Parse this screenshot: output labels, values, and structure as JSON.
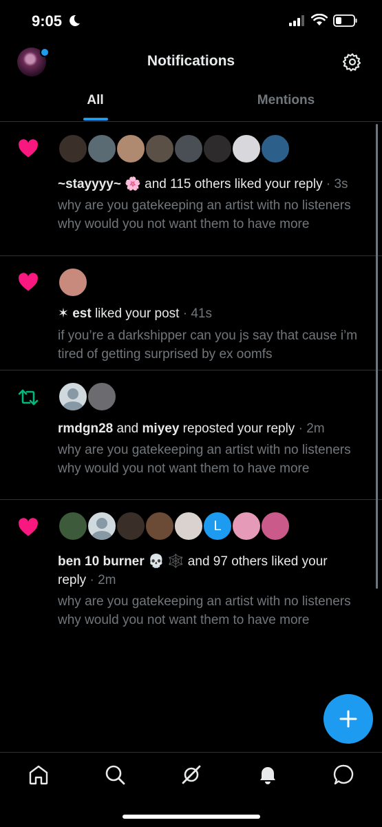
{
  "status_bar": {
    "time": "9:05"
  },
  "header": {
    "title": "Notifications"
  },
  "tabs": [
    {
      "label": "All"
    },
    {
      "label": "Mentions"
    }
  ],
  "notifications": [
    {
      "type": "like",
      "name": "~stayyyy~",
      "emoji": "🌸",
      "text": " and 115 others liked your reply",
      "time": " · 3s",
      "snippet": "why are you gatekeeping an artist with no listeners why would you not want them to have more",
      "avatar_colors": [
        "#3b2f2a",
        "#5a6b74",
        "#b08a70",
        "#5b5046",
        "#4a4f55",
        "#2e2b2c",
        "#d8d8dc",
        "#2c5f8a"
      ]
    },
    {
      "type": "like",
      "name": "✶ est",
      "text": " liked your post",
      "time": " · 41s",
      "snippet": "if you’re a darkshipper can you js say that cause i’m tired of getting surprised by ex oomfs",
      "avatar_colors": [
        "#c98a7e"
      ]
    },
    {
      "type": "repost",
      "name": "rmdgn28",
      "joiner": " and ",
      "name2": "miyey",
      "text": " reposted your reply",
      "time": " · 2m",
      "snippet": "why are you gatekeeping an artist with no listeners why would you not want them to have more",
      "avatar_colors": [
        "#cfd9de",
        "#6b6b70"
      ]
    },
    {
      "type": "like",
      "name": "ben 10 burner",
      "emoji": "💀 🕸️",
      "text": " and 97 others liked your",
      "text2": "reply",
      "time": " · 2m",
      "snippet": "why are you gatekeeping an artist with no listeners why would you not want them to have more",
      "avatar_colors": [
        "#3d5a3a",
        "#cfd9de",
        "#3a2e28",
        "#6b4a36",
        "#d9d2cf",
        "#1d9bf0",
        "#e59ab8",
        "#c95a8a"
      ],
      "avatar_letter": "L"
    }
  ],
  "colors": {
    "like": "#f91880",
    "repost": "#00ba7c",
    "accent": "#1d9bf0"
  },
  "bottom_nav": [
    "home-icon",
    "search-icon",
    "grok-icon",
    "bell-icon",
    "messages-icon"
  ]
}
